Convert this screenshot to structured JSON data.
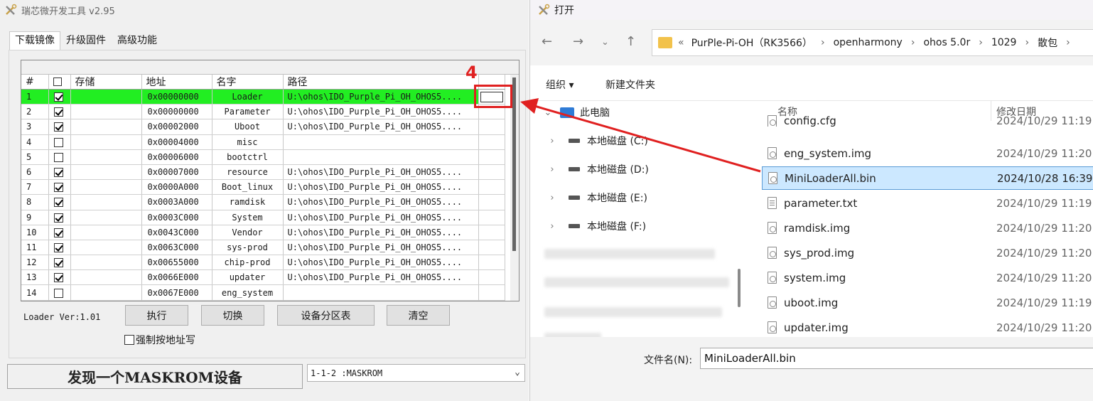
{
  "tool": {
    "title": "瑞芯微开发工具 v2.95",
    "tabs": [
      "下载镜像",
      "升级固件",
      "高级功能"
    ],
    "columns": [
      "#",
      "",
      "存储",
      "地址",
      "名字",
      "路径"
    ],
    "rows": [
      {
        "idx": "1",
        "checked": true,
        "addr": "0x00000000",
        "name": "Loader",
        "path": "U:\\ohos\\IDO_Purple_Pi_OH_OHOS5....",
        "highlight": true
      },
      {
        "idx": "2",
        "checked": true,
        "addr": "0x00000000",
        "name": "Parameter",
        "path": "U:\\ohos\\IDO_Purple_Pi_OH_OHOS5...."
      },
      {
        "idx": "3",
        "checked": true,
        "addr": "0x00002000",
        "name": "Uboot",
        "path": "U:\\ohos\\IDO_Purple_Pi_OH_OHOS5...."
      },
      {
        "idx": "4",
        "checked": false,
        "addr": "0x00004000",
        "name": "misc",
        "path": ""
      },
      {
        "idx": "5",
        "checked": false,
        "addr": "0x00006000",
        "name": "bootctrl",
        "path": ""
      },
      {
        "idx": "6",
        "checked": true,
        "addr": "0x00007000",
        "name": "resource",
        "path": "U:\\ohos\\IDO_Purple_Pi_OH_OHOS5...."
      },
      {
        "idx": "7",
        "checked": true,
        "addr": "0x0000A000",
        "name": "Boot_linux",
        "path": "U:\\ohos\\IDO_Purple_Pi_OH_OHOS5...."
      },
      {
        "idx": "8",
        "checked": true,
        "addr": "0x0003A000",
        "name": "ramdisk",
        "path": "U:\\ohos\\IDO_Purple_Pi_OH_OHOS5...."
      },
      {
        "idx": "9",
        "checked": true,
        "addr": "0x0003C000",
        "name": "System",
        "path": "U:\\ohos\\IDO_Purple_Pi_OH_OHOS5...."
      },
      {
        "idx": "10",
        "checked": true,
        "addr": "0x0043C000",
        "name": "Vendor",
        "path": "U:\\ohos\\IDO_Purple_Pi_OH_OHOS5...."
      },
      {
        "idx": "11",
        "checked": true,
        "addr": "0x0063C000",
        "name": "sys-prod",
        "path": "U:\\ohos\\IDO_Purple_Pi_OH_OHOS5...."
      },
      {
        "idx": "12",
        "checked": true,
        "addr": "0x00655000",
        "name": "chip-prod",
        "path": "U:\\ohos\\IDO_Purple_Pi_OH_OHOS5...."
      },
      {
        "idx": "13",
        "checked": true,
        "addr": "0x0066E000",
        "name": "updater",
        "path": "U:\\ohos\\IDO_Purple_Pi_OH_OHOS5...."
      },
      {
        "idx": "14",
        "checked": false,
        "addr": "0x0067E000",
        "name": "eng_system",
        "path": ""
      }
    ],
    "loader_version": "Loader Ver:1.01",
    "buttons": {
      "run": "执行",
      "switch": "切换",
      "partition": "设备分区表",
      "clear": "清空"
    },
    "force_addr_label": "强制按地址写",
    "status": "发现一个MASKROM设备",
    "device": "1-1-2 :MASKROM",
    "annotation": "4",
    "colors": {
      "highlight_row": "#22ee22",
      "annotation": "#e02020"
    }
  },
  "dialog": {
    "title": "打开",
    "breadcrumb": [
      "PurPle-Pi-OH（RK3566）",
      "openharmony",
      "ohos 5.0r",
      "1029",
      "散包"
    ],
    "toolbar": {
      "organize": "组织 ▾",
      "new_folder": "新建文件夹"
    },
    "nav": {
      "pc": "此电脑",
      "drives": [
        "本地磁盘 (C:)",
        "本地磁盘 (D:)",
        "本地磁盘 (E:)",
        "本地磁盘 (F:)"
      ]
    },
    "columns": {
      "name": "名称",
      "modified": "修改日期"
    },
    "files": [
      {
        "name": "config.cfg",
        "date": "2024/10/29 11:19",
        "icon": "config-file-icon"
      },
      {
        "name": "eng_system.img",
        "date": "2024/10/29 11:20",
        "icon": "image-file-icon"
      },
      {
        "name": "MiniLoaderAll.bin",
        "date": "2024/10/28 16:39",
        "icon": "bin-file-icon",
        "selected": true
      },
      {
        "name": "parameter.txt",
        "date": "2024/10/29 11:19",
        "icon": "text-file-icon"
      },
      {
        "name": "ramdisk.img",
        "date": "2024/10/29 11:20",
        "icon": "image-file-icon"
      },
      {
        "name": "sys_prod.img",
        "date": "2024/10/29 11:20",
        "icon": "image-file-icon"
      },
      {
        "name": "system.img",
        "date": "2024/10/29 11:20",
        "icon": "image-file-icon"
      },
      {
        "name": "uboot.img",
        "date": "2024/10/29 11:19",
        "icon": "image-file-icon"
      },
      {
        "name": "updater.img",
        "date": "2024/10/29 11:20",
        "icon": "image-file-icon"
      }
    ],
    "filename_label": "文件名(N):",
    "filename_value": "MiniLoaderAll.bin",
    "colors": {
      "selected_row": "#cce8ff",
      "folder": "#f2c24b"
    }
  }
}
